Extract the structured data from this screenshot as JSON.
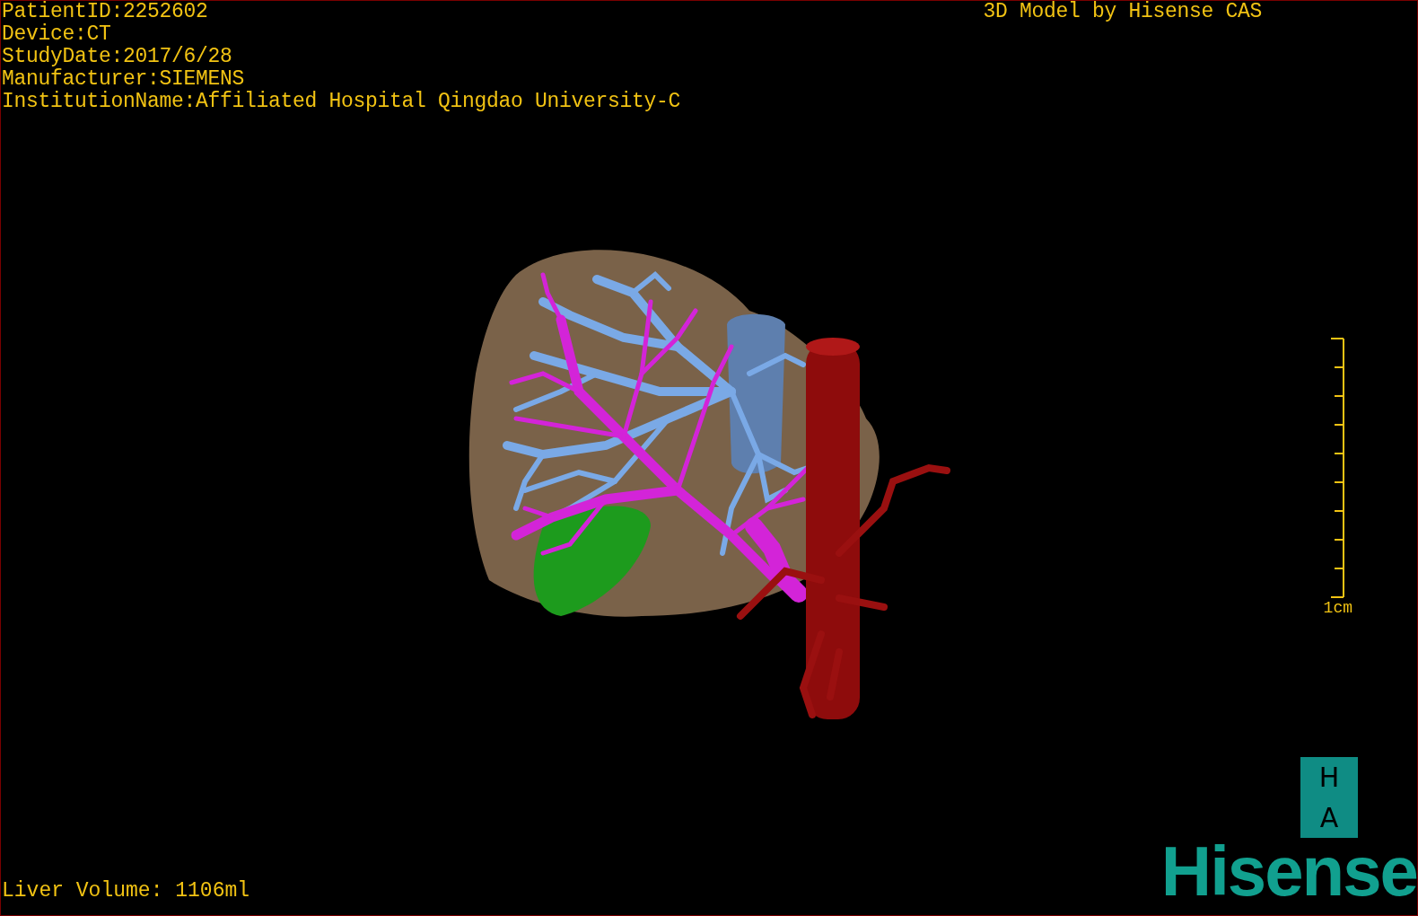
{
  "overlay": {
    "info_lines": [
      "PatientID:2252602",
      "Device:CT",
      "StudyDate:2017/6/28",
      "Manufacturer:SIEMENS",
      "InstitutionName:Affiliated Hospital Qingdao University-C"
    ],
    "title": "3D Model by Hisense CAS"
  },
  "scale_bar": {
    "label": "1cm"
  },
  "orientation_cube": {
    "top": "H",
    "bottom": "A"
  },
  "logo": "Hisense",
  "footer": "Liver Volume: 1106ml"
}
